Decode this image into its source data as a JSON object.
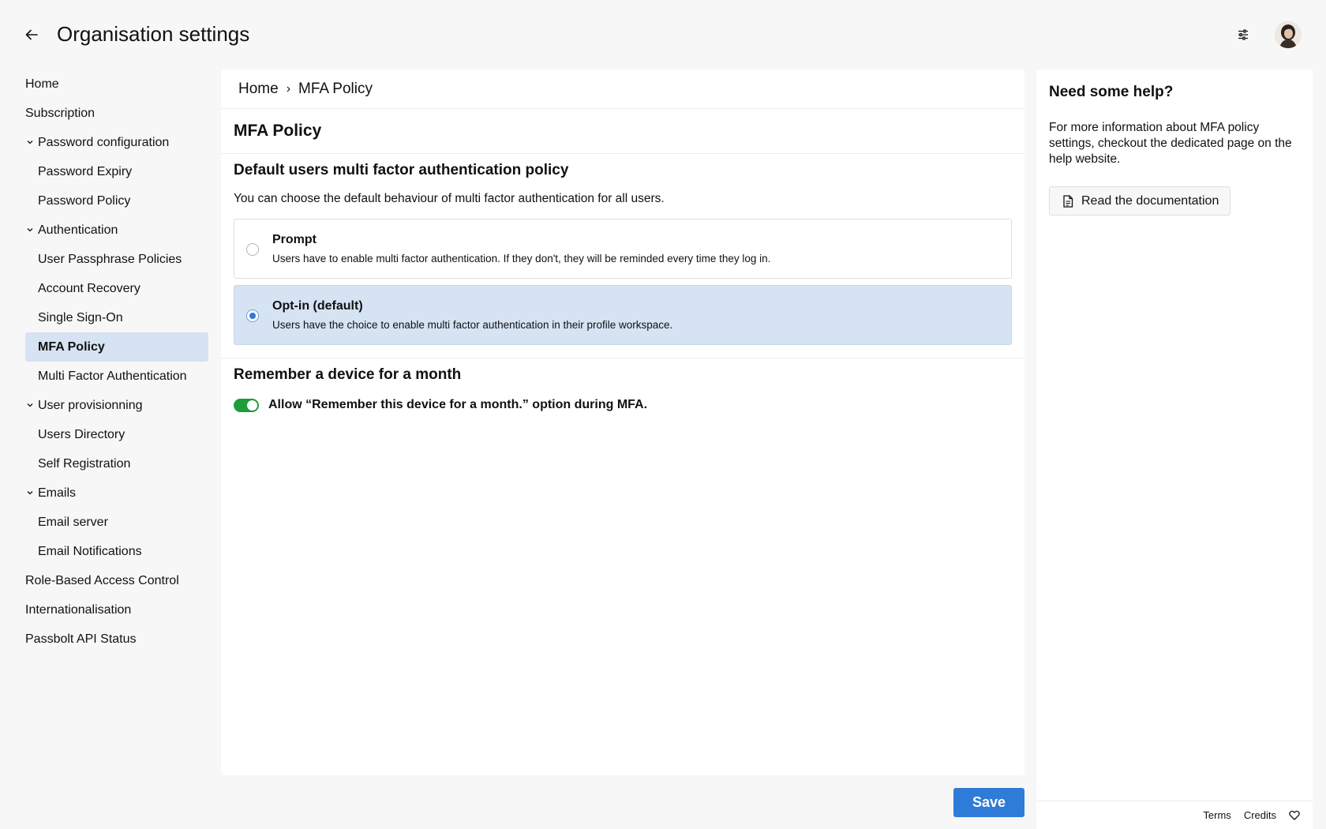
{
  "header": {
    "title": "Organisation settings",
    "back_icon": "arrow-left-icon",
    "filter_icon": "sliders-icon"
  },
  "sidebar": {
    "items": [
      {
        "label": "Home"
      },
      {
        "label": "Subscription"
      },
      {
        "label": "Password configuration"
      },
      {
        "label": "Password Expiry"
      },
      {
        "label": "Password Policy"
      },
      {
        "label": "Authentication"
      },
      {
        "label": "User Passphrase Policies"
      },
      {
        "label": "Account Recovery"
      },
      {
        "label": "Single Sign-On"
      },
      {
        "label": "MFA Policy"
      },
      {
        "label": "Multi Factor Authentication"
      },
      {
        "label": "User provisionning"
      },
      {
        "label": "Users Directory"
      },
      {
        "label": "Self Registration"
      },
      {
        "label": "Emails"
      },
      {
        "label": "Email server"
      },
      {
        "label": "Email Notifications"
      },
      {
        "label": "Role-Based Access Control"
      },
      {
        "label": "Internationalisation"
      },
      {
        "label": "Passbolt API Status"
      }
    ],
    "active": "MFA Policy"
  },
  "breadcrumb": {
    "home": "Home",
    "separator": "›",
    "current": "MFA Policy"
  },
  "main": {
    "title": "MFA Policy",
    "policy_heading": "Default users multi factor authentication policy",
    "policy_desc": "You can choose the default behaviour of multi factor authentication for all users.",
    "options": [
      {
        "title": "Prompt",
        "desc": "Users have to enable multi factor authentication. If they don't, they will be reminded every time they log in.",
        "selected": false
      },
      {
        "title": "Opt-in (default)",
        "desc": "Users have the choice to enable multi factor authentication in their profile workspace.",
        "selected": true
      }
    ],
    "remember_heading": "Remember a device for a month",
    "remember_label": "Allow “Remember this device for a month.” option during MFA.",
    "remember_enabled": true
  },
  "actions": {
    "save_label": "Save"
  },
  "help": {
    "title": "Need some help?",
    "text": "For more information about MFA policy settings, checkout the dedicated page on the help website.",
    "doc_button": "Read the documentation",
    "doc_icon": "document-icon"
  },
  "footer": {
    "terms": "Terms",
    "credits": "Credits",
    "heart_icon": "heart-icon"
  },
  "colors": {
    "accent": "#2f7bd8",
    "selected_bg": "#d5e3f3",
    "toggle_on": "#1e9b3a",
    "page_bg": "#f7f7f7"
  }
}
